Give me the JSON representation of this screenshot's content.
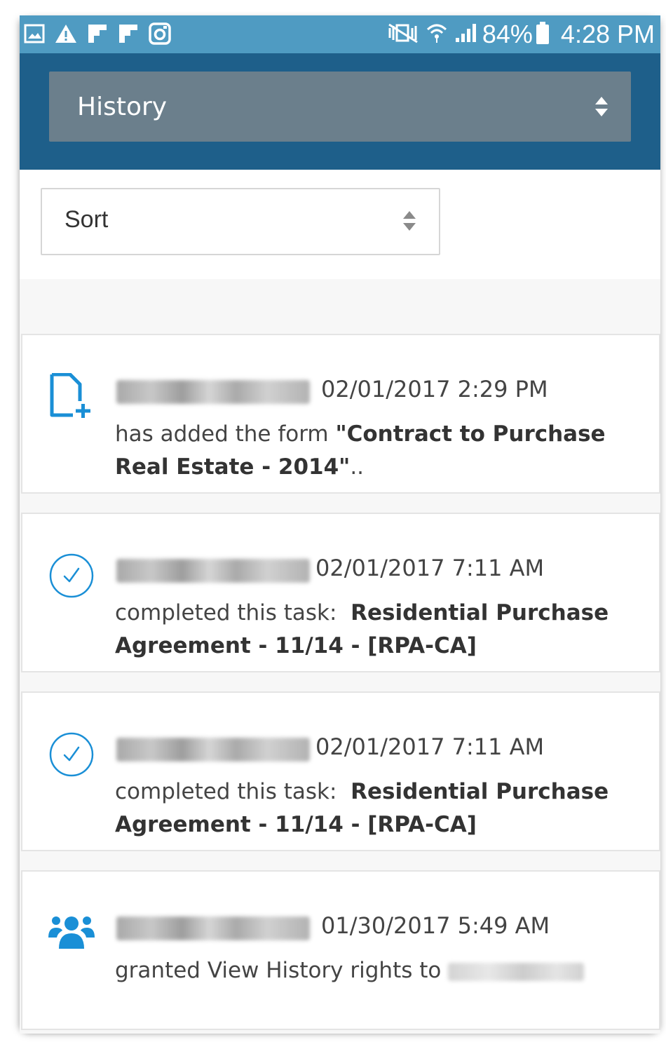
{
  "status_bar": {
    "battery": "84%",
    "time": "4:28 PM",
    "left_icons": [
      "image-icon",
      "warning-icon",
      "flipboard-icon",
      "flipboard-icon",
      "instagram-icon"
    ],
    "right_icons": [
      "mute-vibrate-icon",
      "wifi-icon",
      "signal-icon",
      "battery-icon"
    ]
  },
  "header": {
    "view_select_value": "History"
  },
  "sort": {
    "value": "Sort"
  },
  "colors": {
    "status_bar": "#4f9bc2",
    "header": "#1e5f8a",
    "select_bg": "#6b7f8c",
    "accent_blue": "#1a8fd6"
  },
  "activities": [
    {
      "icon": "add-document-icon",
      "timestamp": "02/01/2017 2:29 PM",
      "text": "has added the form ",
      "highlight": "\"Contract to Purchase Real Estate - 2014\"",
      "suffix": ".."
    },
    {
      "icon": "check-circle-icon",
      "timestamp": "02/01/2017 7:11 AM",
      "text": "completed this task:  ",
      "highlight": "Residential Purchase Agreement - 11/14 - [RPA-CA]",
      "suffix": ""
    },
    {
      "icon": "check-circle-icon",
      "timestamp": "02/01/2017 7:11 AM",
      "text": "completed this task:  ",
      "highlight": "Residential Purchase Agreement - 11/14 - [RPA-CA]",
      "suffix": ""
    },
    {
      "icon": "users-icon",
      "timestamp": "01/30/2017 5:49 AM",
      "text": "granted View History rights to ",
      "highlight": "",
      "suffix": ""
    }
  ]
}
